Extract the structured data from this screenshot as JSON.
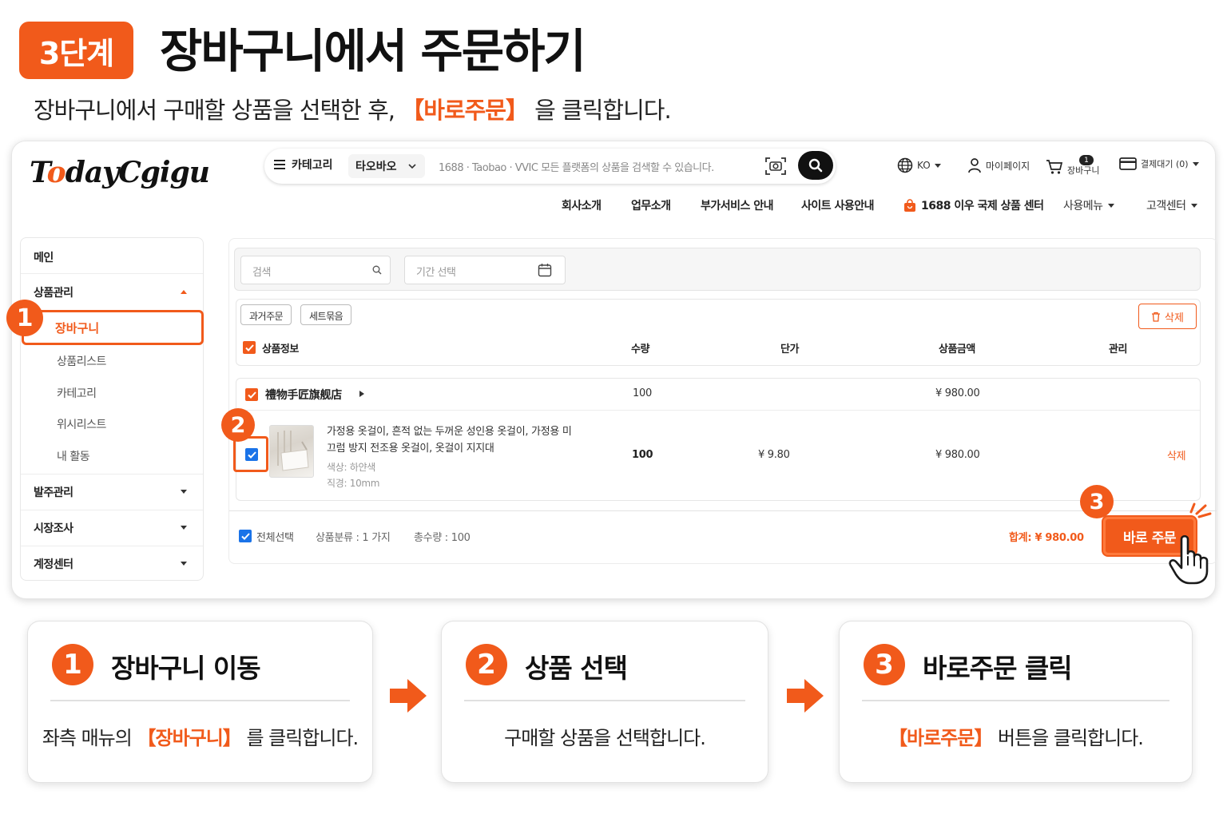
{
  "header": {
    "step_badge": "3단계",
    "title": "장바구니에서 주문하기",
    "subtitle_pre": "장바구니에서 구매할 상품을 선택한 후, ",
    "subtitle_highlight": "【바로주문】",
    "subtitle_post": " 을 클릭합니다."
  },
  "site": {
    "logo_pre": "T",
    "logo_o": "o",
    "logo_post": "dayCgigu",
    "category_label": "카테고리",
    "platform_selected": "타오바오",
    "search_placeholder": "1688 · Taobao · VVIC 모든 플랫폼의 상품을 검색할 수 있습니다.",
    "util": {
      "language": "KO",
      "mypage": "마이페이지",
      "cart_label": "장바구니",
      "cart_count": "1",
      "pending_payment": "결제대기 (0)"
    },
    "nav": [
      "회사소개",
      "업무소개",
      "부가서비스 안내",
      "사이트 사용안내",
      "1688 이우 국제 상품 센터",
      "사용메뉴",
      "고객센터"
    ]
  },
  "sidebar": {
    "main": "메인",
    "product_mgmt": "상품관리",
    "cart": "장바구니",
    "sub_items": [
      "상품리스트",
      "카테고리",
      "위시리스트",
      "내 활동"
    ],
    "order_mgmt": "발주관리",
    "market_research": "시장조사",
    "account_center": "계정센터"
  },
  "filters": {
    "search_placeholder": "검색",
    "date_placeholder": "기간 선택"
  },
  "table": {
    "chips": [
      "과거주문",
      "세트묶음"
    ],
    "delete_label": "삭제",
    "headers": {
      "product_info": "상품정보",
      "quantity": "수량",
      "unit_price": "단가",
      "amount": "상품금액",
      "manage": "관리"
    },
    "shop": {
      "name": "禮物手匠旗舰店",
      "quantity": "100",
      "amount": "¥ 980.00"
    },
    "item": {
      "title_line1": "가정용 옷걸이, 흔적 없는 두꺼운 성인용 옷걸이, 가정용 미",
      "title_line2": "끄럼 방지 전조용 옷걸이, 옷걸이 지지대",
      "option_color": "색상: 하얀색",
      "option_size": "직경: 10mm",
      "quantity": "100",
      "unit_price": "¥ 9.80",
      "amount": "¥ 980.00",
      "delete": "삭제"
    },
    "footer": {
      "select_all": "전체선택",
      "category_count": "상품분류 : 1 가지",
      "total_quantity": "총수량 : 100",
      "total": "합계: ¥ 980.00",
      "order_button": "바로 주문"
    }
  },
  "markers": [
    "1",
    "2",
    "3"
  ],
  "steps": [
    {
      "num": "1",
      "title": "장바구니 이동",
      "desc_pre": "좌측 매뉴의 ",
      "desc_hl": "【장바구니】",
      "desc_post": " 를 클릭합니다."
    },
    {
      "num": "2",
      "title": "상품 선택",
      "desc_pre": "구매할 상품을 선택합니다.",
      "desc_hl": "",
      "desc_post": ""
    },
    {
      "num": "3",
      "title": "바로주문 클릭",
      "desc_pre": "",
      "desc_hl": "【바로주문】",
      "desc_post": " 버튼을 클릭합니다."
    }
  ],
  "colors": {
    "accent": "#f15a1b",
    "checkbox_blue": "#1a73e8"
  }
}
